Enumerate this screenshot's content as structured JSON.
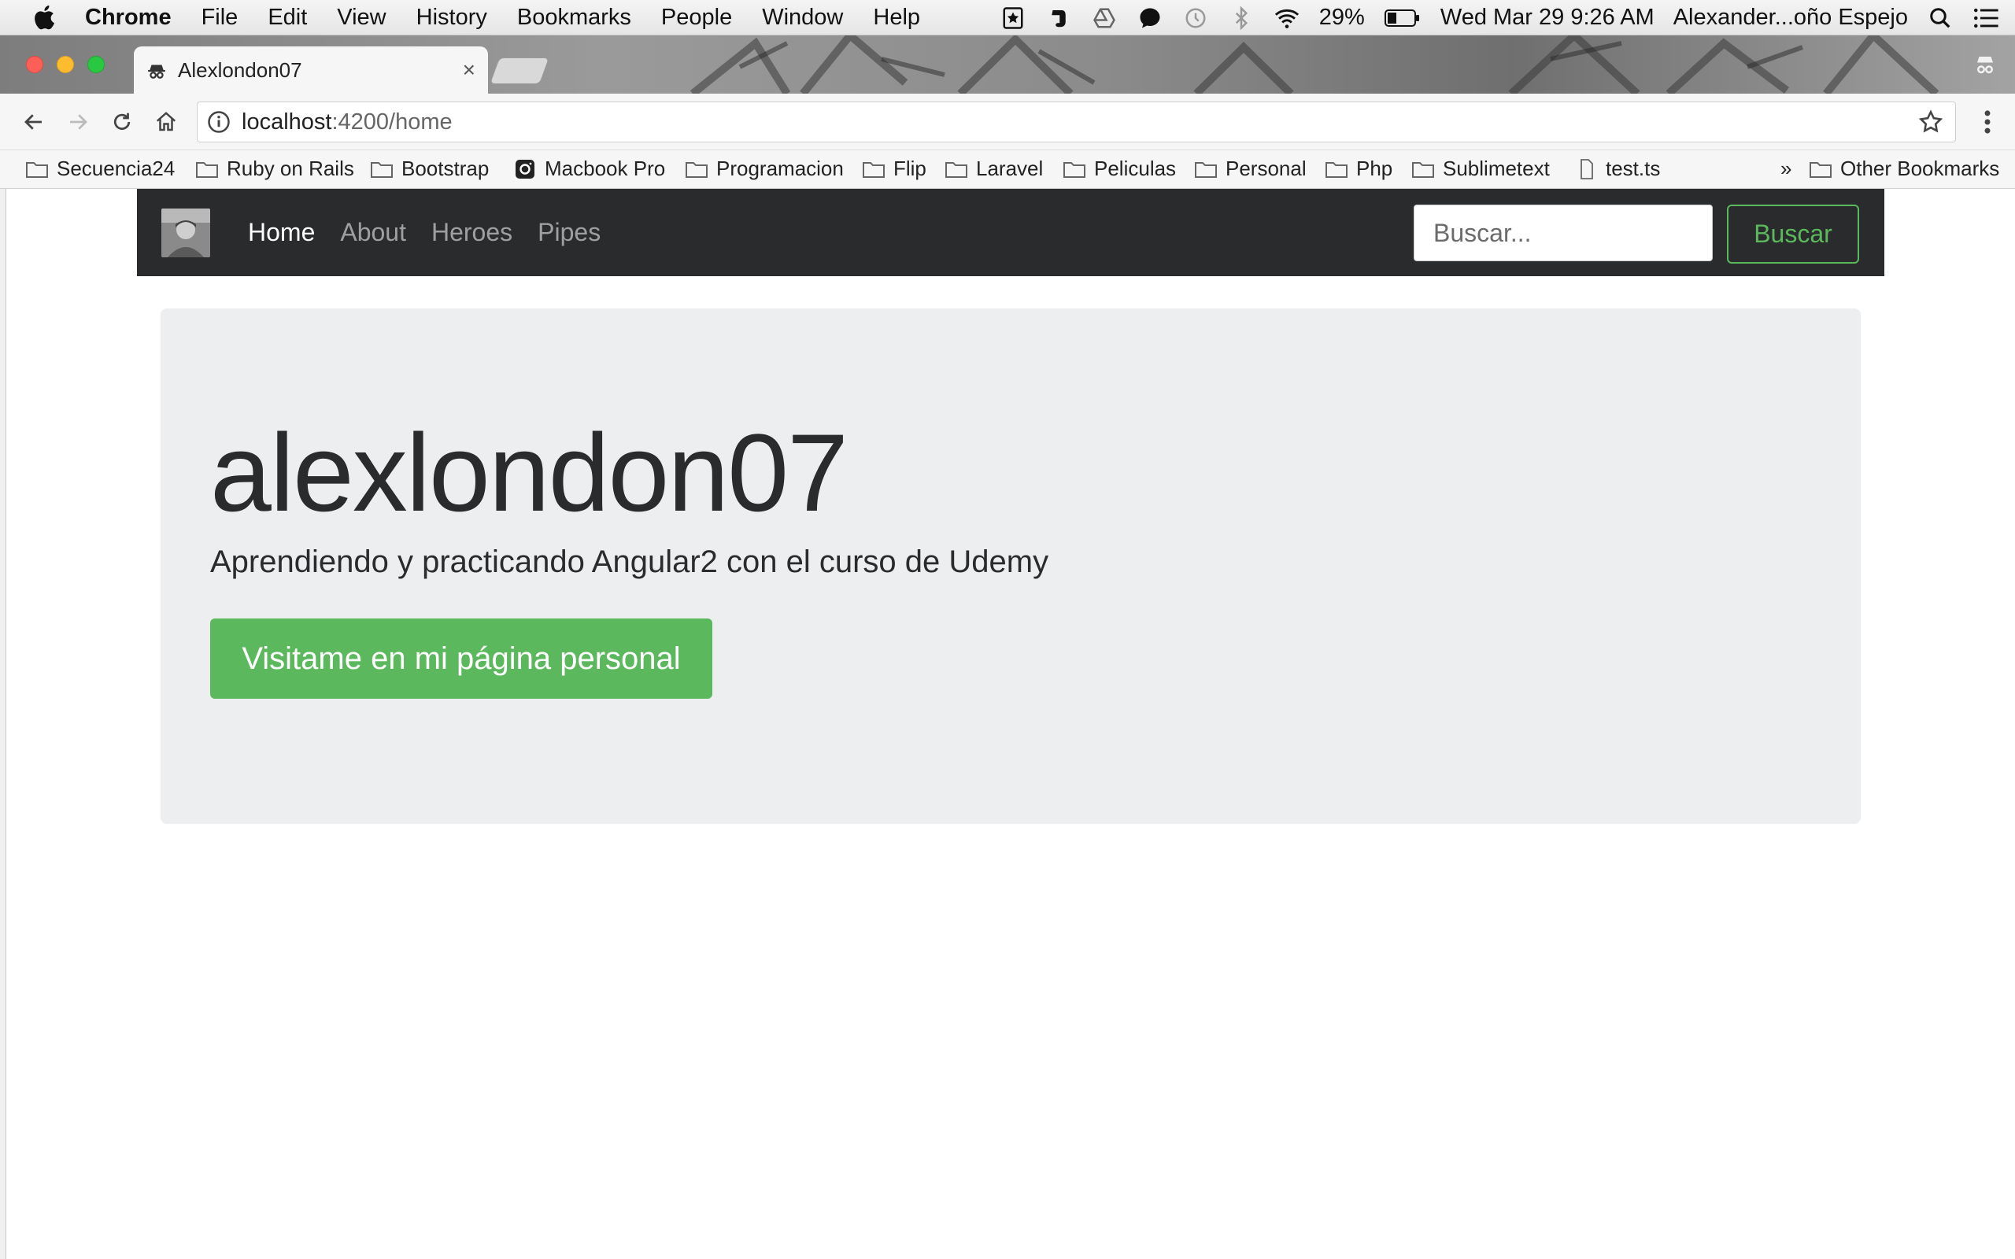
{
  "menubar": {
    "app": "Chrome",
    "items": [
      "File",
      "Edit",
      "View",
      "History",
      "Bookmarks",
      "People",
      "Window",
      "Help"
    ],
    "battery": "29%",
    "datetime": "Wed Mar 29  9:26 AM",
    "user": "Alexander...oño Espejo"
  },
  "browser": {
    "tab_title": "Alexlondon07",
    "tab_close": "×",
    "url_host": "localhost",
    "url_rest": ":4200/home"
  },
  "bookmarks": {
    "items": [
      "Secuencia24",
      "Ruby on Rails",
      "Bootstrap",
      "Macbook Pro",
      "Programacion",
      "Flip",
      "Laravel",
      "Peliculas",
      "Personal",
      "Php",
      "Sublimetext",
      "test.ts"
    ],
    "overflow": "»",
    "other": "Other Bookmarks"
  },
  "navbar": {
    "links": [
      "Home",
      "About",
      "Heroes",
      "Pipes"
    ],
    "search_placeholder": "Buscar...",
    "search_button": "Buscar"
  },
  "jumbotron": {
    "title": "alexlondon07",
    "lead": "Aprendiendo y practicando Angular2 con el curso de Udemy",
    "button": "Visitame en mi página personal"
  }
}
